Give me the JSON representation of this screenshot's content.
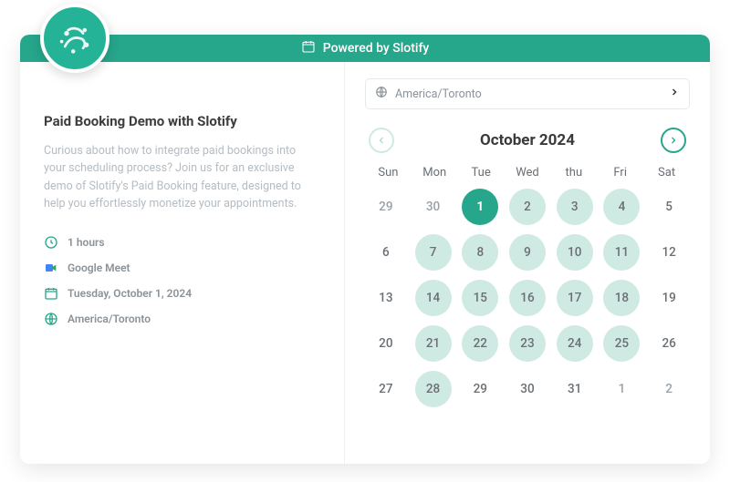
{
  "header": {
    "powered_by": "Powered by Slotify"
  },
  "brand_color": "#26a68b",
  "left": {
    "title": "Paid Booking Demo with Slotify",
    "description": "Curious about how to integrate paid bookings into your scheduling process? Join us for an exclusive demo of Slotify's Paid Booking feature, designed to help you effortlessly monetize your appointments.",
    "duration": "1 hours",
    "location": "Google Meet",
    "date": "Tuesday, October 1, 2024",
    "timezone": "America/Toronto"
  },
  "timezone_picker": {
    "value": "America/Toronto"
  },
  "calendar": {
    "month_label": "October 2024",
    "prev_enabled": false,
    "next_enabled": true,
    "dow": [
      "Sun",
      "Mon",
      "Tue",
      "Wed",
      "thu",
      "Fri",
      "Sat"
    ],
    "days": [
      {
        "n": 29,
        "state": "out"
      },
      {
        "n": 30,
        "state": "out"
      },
      {
        "n": 1,
        "state": "selected"
      },
      {
        "n": 2,
        "state": "avail"
      },
      {
        "n": 3,
        "state": "avail"
      },
      {
        "n": 4,
        "state": "avail"
      },
      {
        "n": 5,
        "state": "none"
      },
      {
        "n": 6,
        "state": "none"
      },
      {
        "n": 7,
        "state": "avail"
      },
      {
        "n": 8,
        "state": "avail"
      },
      {
        "n": 9,
        "state": "avail"
      },
      {
        "n": 10,
        "state": "avail"
      },
      {
        "n": 11,
        "state": "avail"
      },
      {
        "n": 12,
        "state": "none"
      },
      {
        "n": 13,
        "state": "none"
      },
      {
        "n": 14,
        "state": "avail"
      },
      {
        "n": 15,
        "state": "avail"
      },
      {
        "n": 16,
        "state": "avail"
      },
      {
        "n": 17,
        "state": "avail"
      },
      {
        "n": 18,
        "state": "avail"
      },
      {
        "n": 19,
        "state": "none"
      },
      {
        "n": 20,
        "state": "none"
      },
      {
        "n": 21,
        "state": "avail"
      },
      {
        "n": 22,
        "state": "avail"
      },
      {
        "n": 23,
        "state": "avail"
      },
      {
        "n": 24,
        "state": "avail"
      },
      {
        "n": 25,
        "state": "avail"
      },
      {
        "n": 26,
        "state": "none"
      },
      {
        "n": 27,
        "state": "none"
      },
      {
        "n": 28,
        "state": "avail"
      },
      {
        "n": 29,
        "state": "none"
      },
      {
        "n": 30,
        "state": "none"
      },
      {
        "n": 31,
        "state": "none"
      },
      {
        "n": 1,
        "state": "out"
      },
      {
        "n": 2,
        "state": "out"
      }
    ]
  }
}
